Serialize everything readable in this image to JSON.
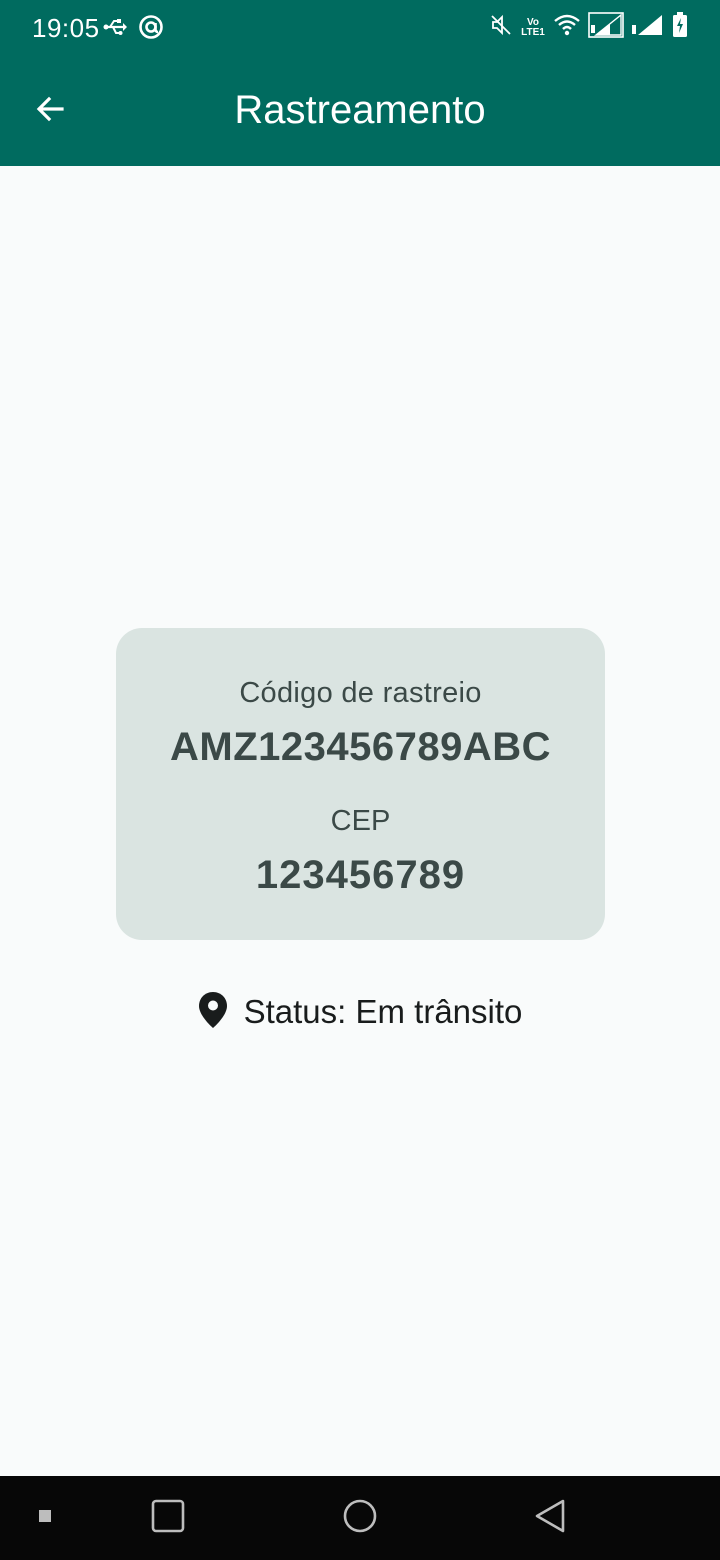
{
  "status_bar": {
    "time": "19:05",
    "volte_top": "Vo",
    "volte_bottom": "LTE1"
  },
  "app_bar": {
    "title": "Rastreamento"
  },
  "card": {
    "tracking_label": "Código de rastreio",
    "tracking_code": "AMZ123456789ABC",
    "cep_label": "CEP",
    "cep_value": "123456789"
  },
  "status": {
    "text": "Status: Em trânsito"
  },
  "icons": {
    "back": "arrow-back-icon",
    "location": "location-pin-icon"
  },
  "colors": {
    "primary": "#006b5f",
    "card_background": "#dae4e1",
    "page_background": "#f9fbfb"
  }
}
